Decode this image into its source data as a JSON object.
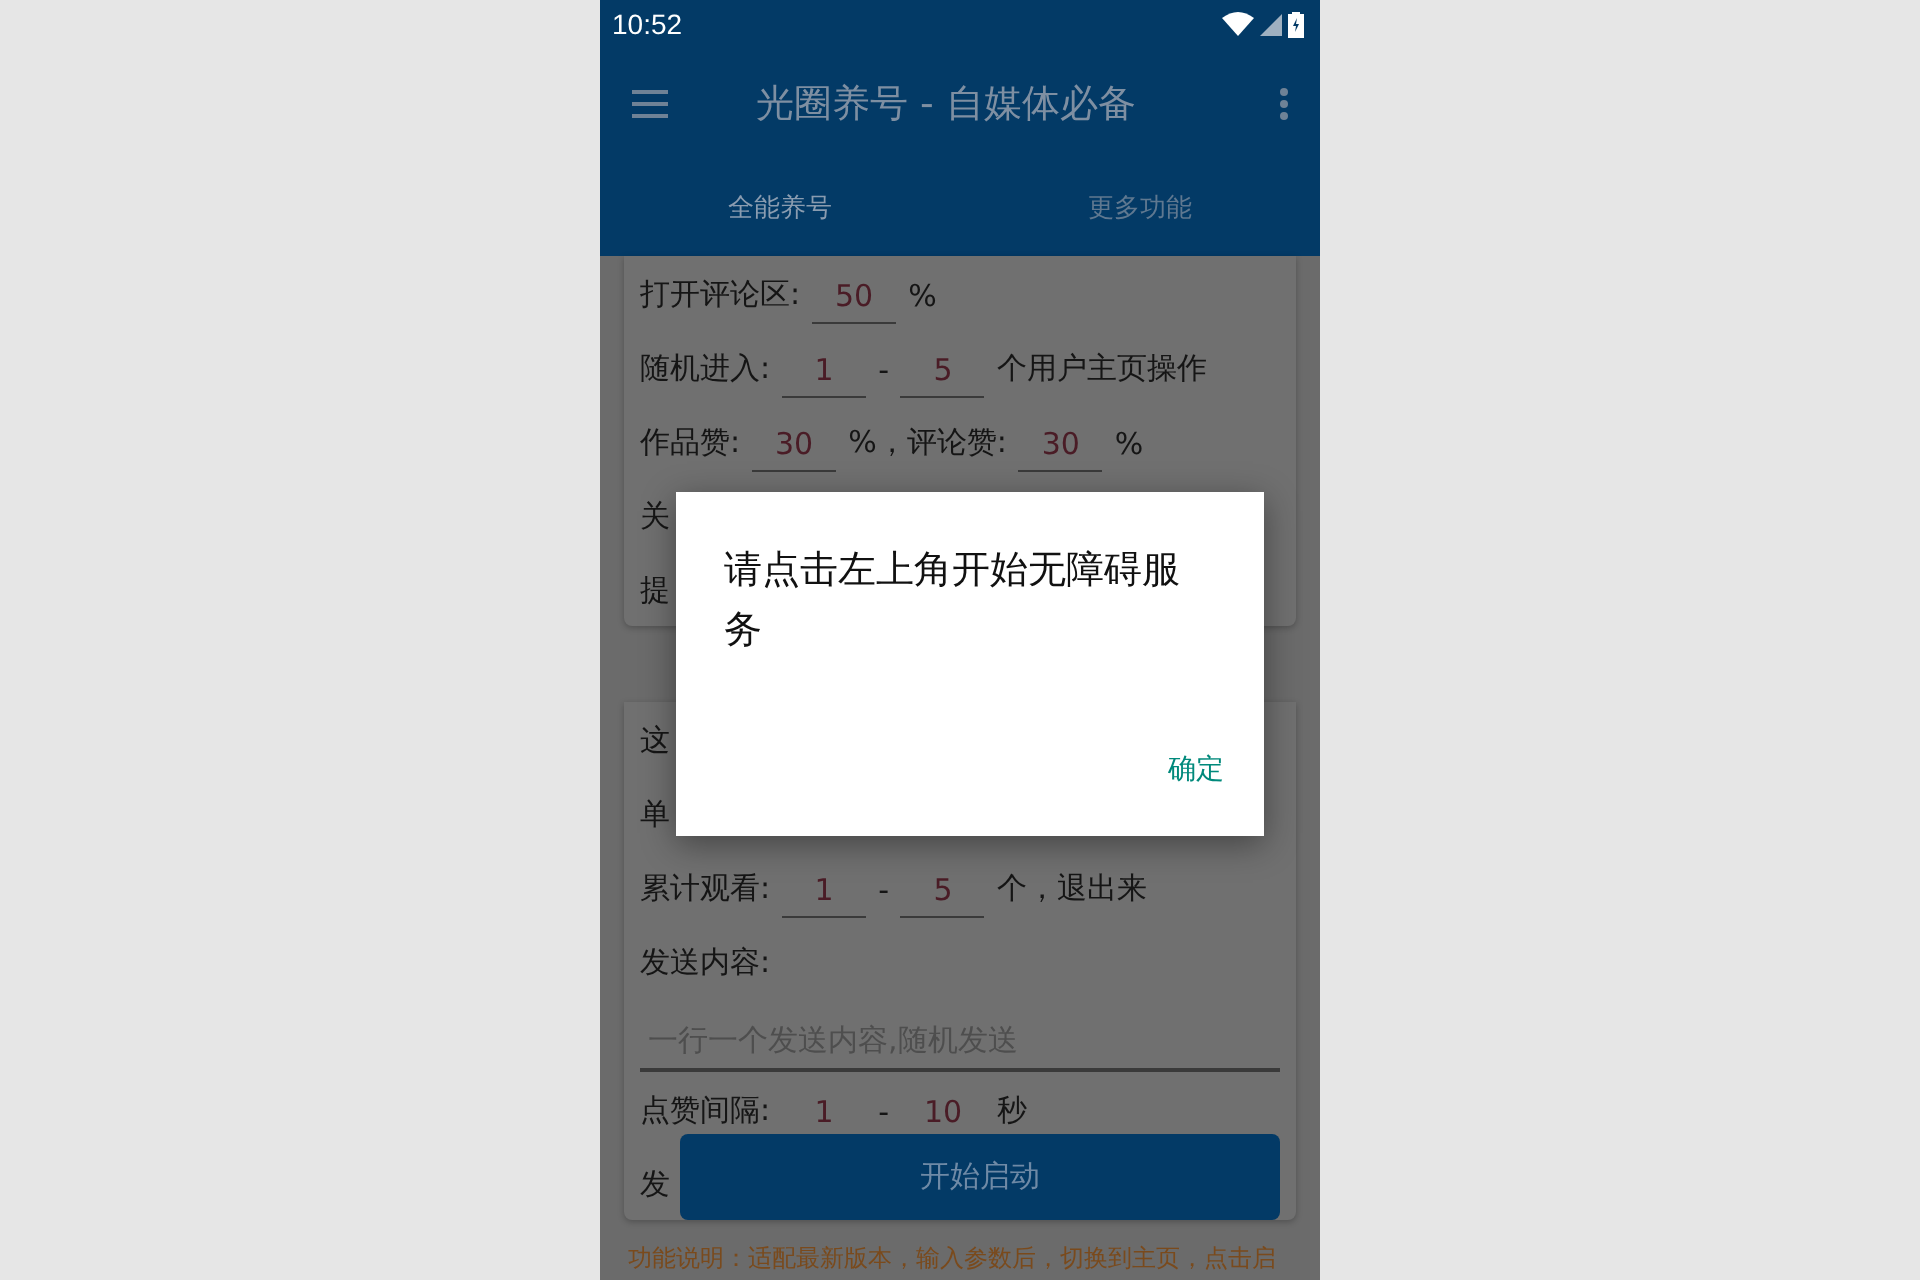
{
  "status_bar": {
    "time": "10:52"
  },
  "toolbar": {
    "title": "光圈养号 - 自媒体必备"
  },
  "tabs": [
    {
      "label": "全能养号",
      "selected": true
    },
    {
      "label": "更多功能",
      "selected": false
    }
  ],
  "cards": [
    {
      "rows": [
        {
          "parts": [
            {
              "kind": "text",
              "text": "打开评论区:"
            },
            {
              "kind": "field",
              "value": "50"
            },
            {
              "kind": "text",
              "text": "%"
            }
          ]
        },
        {
          "parts": [
            {
              "kind": "text",
              "text": "随机进入:"
            },
            {
              "kind": "field",
              "value": "1"
            },
            {
              "kind": "text",
              "text": "-"
            },
            {
              "kind": "field",
              "value": "5"
            },
            {
              "kind": "text",
              "text": "个用户主页操作"
            }
          ]
        },
        {
          "parts": [
            {
              "kind": "text",
              "text": "作品赞:"
            },
            {
              "kind": "field",
              "value": "30"
            },
            {
              "kind": "text",
              "text": "%，评论赞:"
            },
            {
              "kind": "field",
              "value": "30"
            },
            {
              "kind": "text",
              "text": "%"
            }
          ]
        },
        {
          "parts": [
            {
              "kind": "text",
              "text": "关"
            }
          ]
        },
        {
          "parts": [
            {
              "kind": "text",
              "text": "提"
            }
          ]
        }
      ]
    },
    {
      "rows": [
        {
          "parts": [
            {
              "kind": "text",
              "text": "这"
            }
          ]
        },
        {
          "parts": [
            {
              "kind": "text",
              "text": "单"
            }
          ]
        },
        {
          "parts": [
            {
              "kind": "text",
              "text": "累计观看:"
            },
            {
              "kind": "field",
              "value": "1"
            },
            {
              "kind": "text",
              "text": "-"
            },
            {
              "kind": "field",
              "value": "5"
            },
            {
              "kind": "text",
              "text": "个，退出来"
            }
          ]
        },
        {
          "parts": [
            {
              "kind": "text",
              "text": "发送内容:"
            }
          ]
        },
        {
          "parts": [
            {
              "kind": "wide",
              "placeholder": "一行一个发送内容,随机发送"
            }
          ]
        },
        {
          "parts": [
            {
              "kind": "text",
              "text": "点赞间隔:"
            },
            {
              "kind": "field",
              "value": "1"
            },
            {
              "kind": "text",
              "text": "-"
            },
            {
              "kind": "field",
              "value": "10"
            },
            {
              "kind": "text",
              "text": "秒"
            }
          ]
        },
        {
          "parts": [
            {
              "kind": "text",
              "text": "发"
            }
          ]
        }
      ]
    }
  ],
  "start_button": "开始启动",
  "footnote": "功能说明：适配最新版本，输入参数后，切换到主页，点击启",
  "dialog": {
    "message": "请点击左上角开始无障碍服务",
    "button": "确定"
  }
}
